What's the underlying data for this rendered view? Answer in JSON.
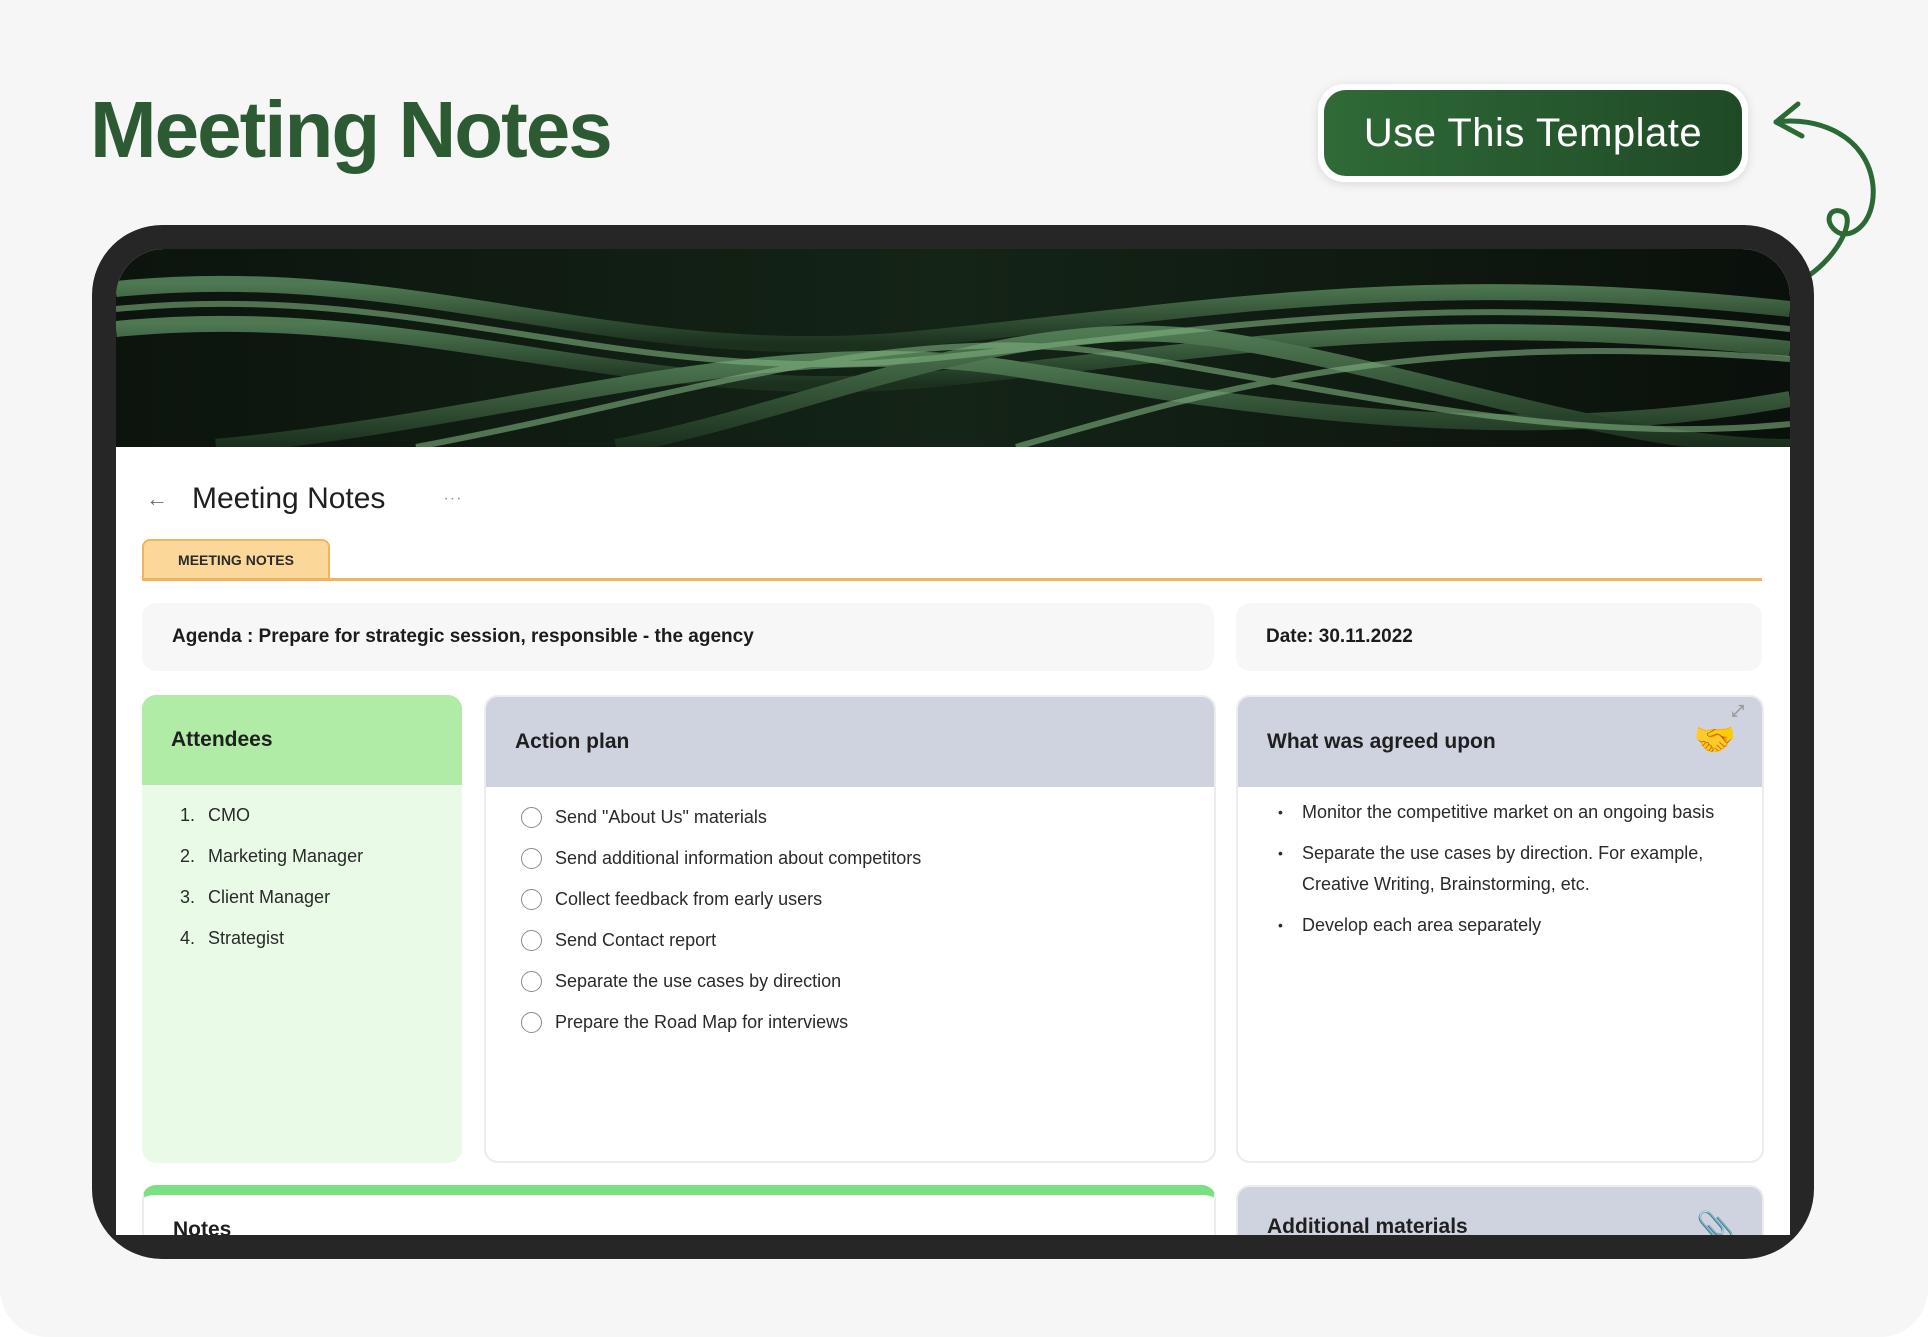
{
  "header": {
    "title": "Meeting Notes",
    "cta_label": "Use This Template"
  },
  "colors": {
    "brand_green": "#2c5b33",
    "attendees_header": "#b0eca6",
    "attendees_body": "#e9fbe7",
    "card_header_gray": "#cfd2df",
    "tab_orange": "#fbd89a",
    "notes_accent": "#7be082"
  },
  "document": {
    "title": "Meeting Notes",
    "more_label": "···",
    "tab_label": "MEETING NOTES",
    "agenda": "Agenda : Prepare for strategic session, responsible - the agency",
    "date": "Date: 30.11.2022"
  },
  "attendees": {
    "title": "Attendees",
    "items": [
      {
        "num": "1.",
        "name": "CMO"
      },
      {
        "num": "2.",
        "name": "Marketing Manager"
      },
      {
        "num": "3.",
        "name": "Client Manager"
      },
      {
        "num": "4.",
        "name": "Strategist"
      }
    ]
  },
  "action_plan": {
    "title": "Action plan",
    "items": [
      "Send \"About Us\" materials",
      "Send additional information about competitors",
      "Collect feedback from early users",
      "Send Contact report",
      "Separate the use cases by direction",
      "Prepare the Road Map for interviews"
    ]
  },
  "agreed": {
    "title": "What was agreed upon",
    "icon": "handshake-icon",
    "items": [
      "Monitor the competitive market on an ongoing basis",
      "Separate the use cases by direction. For example, Creative Writing, Brainstorming, etc.",
      "Develop each area separately"
    ]
  },
  "notes": {
    "title": "Notes"
  },
  "additional": {
    "title": "Additional materials",
    "icon": "paperclip-icon"
  }
}
